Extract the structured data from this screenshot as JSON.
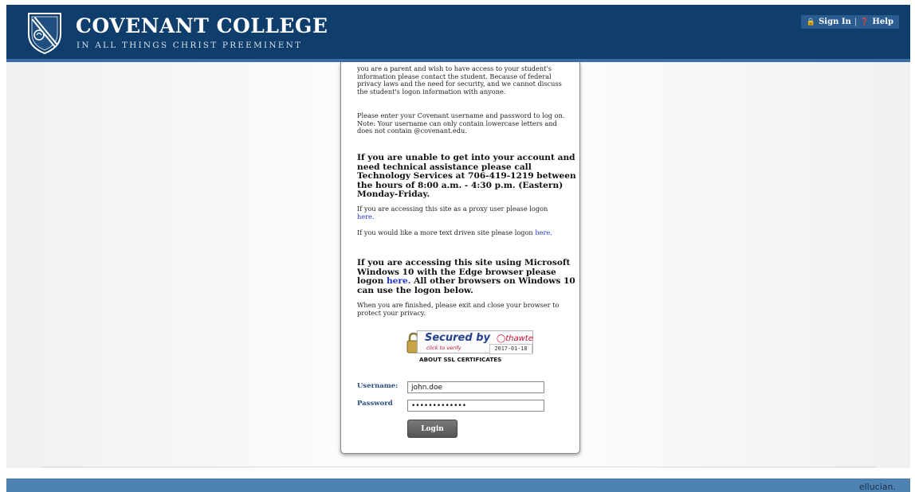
{
  "header": {
    "title": "COVENANT COLLEGE",
    "tagline": "IN ALL THINGS CHRIST PREEMINENT",
    "sign_in": "Sign In",
    "separator": "|",
    "help": "Help"
  },
  "panel": {
    "intro": "you are a parent and wish to have access to your student's information please contact the student. Because of federal privacy laws and the need for security, and we cannot discuss the student's logon information with anyone.",
    "instructions": "Please enter your Covenant username and password to log on. Note: Your username can only contain lowercase letters and does not contain @covenant.edu.",
    "support": "If you are unable to get into your account and need technical assistance please call Technology Services at 706-419-1219 between the hours of 8:00 a.m. - 4:30 p.m. (Eastern) Monday-Friday.",
    "proxy_text": "If you are accessing this site as a proxy user please logon",
    "proxy_link": "here.",
    "text_site_text": "If you would like a more text driven site please logon",
    "text_site_link": "here.",
    "edge_text_1": "If you are accessing this site using Microsoft Windows 10 with the Edge browser please logon",
    "edge_link": "here.",
    "edge_text_2": "All other browsers on Windows 10 can use the logon below.",
    "exit_text": "When you are finished, please exit and close your browser to protect your privacy."
  },
  "ssl": {
    "secured_by": "Secured by",
    "brand": "thawte",
    "verify": "click to verify",
    "date": "2017-01-18",
    "about": "ABOUT SSL CERTIFICATES"
  },
  "form": {
    "username_label": "Username:",
    "username_value": "john.doe",
    "password_label": "Password",
    "password_value": "•••••••••••••",
    "login_label": "Login"
  },
  "footer": {
    "brand": "ellucian."
  },
  "colors": {
    "header_bg": "#0f3e6d",
    "footer_bg": "#4d82b3",
    "link": "#1f33c4"
  }
}
